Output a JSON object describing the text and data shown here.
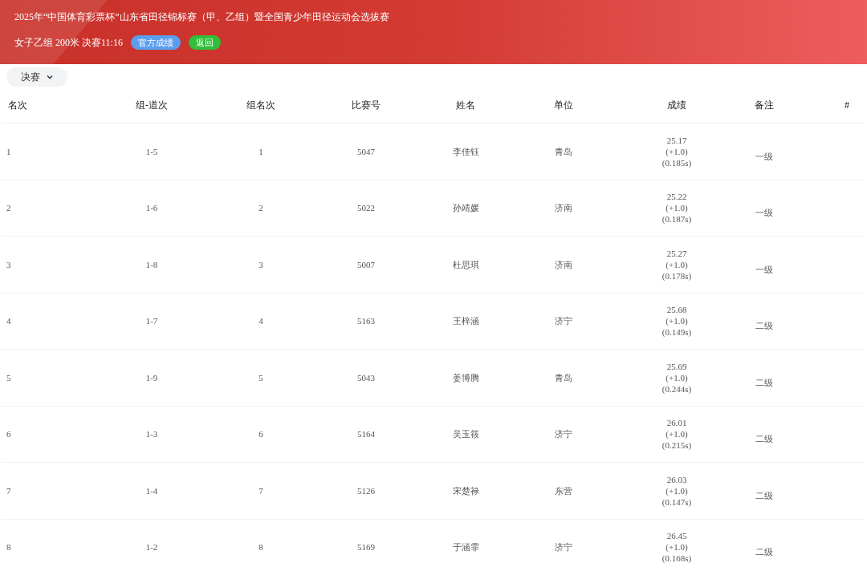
{
  "header": {
    "title": "2025年“中国体育彩票杯”山东省田径锦标赛（甲、乙组）暨全国青少年田径运动会选拔赛",
    "subtitle": "女子乙组 200米 决赛11:16",
    "buttons": [
      {
        "label": "官方成绩",
        "kind": "primary"
      },
      {
        "label": "返回",
        "kind": "success"
      }
    ]
  },
  "round_select": {
    "value": "决赛"
  },
  "table": {
    "columns": [
      "名次",
      "组-道次",
      "组名次",
      "比赛号",
      "姓名",
      "单位",
      "成绩",
      "备注",
      "#"
    ],
    "rows": [
      {
        "rank": "1",
        "group_lane": "1-5",
        "group_rank": "1",
        "bib": "5047",
        "name": "李佳钰",
        "unit": "青岛",
        "time": "25.17",
        "wind": "(+1.0)",
        "reaction": "(0.185s)",
        "note": "一级"
      },
      {
        "rank": "2",
        "group_lane": "1-6",
        "group_rank": "2",
        "bib": "5022",
        "name": "孙靖媛",
        "unit": "济南",
        "time": "25.22",
        "wind": "(+1.0)",
        "reaction": "(0.187s)",
        "note": "一级"
      },
      {
        "rank": "3",
        "group_lane": "1-8",
        "group_rank": "3",
        "bib": "5007",
        "name": "杜思琪",
        "unit": "济南",
        "time": "25.27",
        "wind": "(+1.0)",
        "reaction": "(0.178s)",
        "note": "一级"
      },
      {
        "rank": "4",
        "group_lane": "1-7",
        "group_rank": "4",
        "bib": "5163",
        "name": "王梓涵",
        "unit": "济宁",
        "time": "25.68",
        "wind": "(+1.0)",
        "reaction": "(0.149s)",
        "note": "二级"
      },
      {
        "rank": "5",
        "group_lane": "1-9",
        "group_rank": "5",
        "bib": "5043",
        "name": "姜博腾",
        "unit": "青岛",
        "time": "25.69",
        "wind": "(+1.0)",
        "reaction": "(0.244s)",
        "note": "二级"
      },
      {
        "rank": "6",
        "group_lane": "1-3",
        "group_rank": "6",
        "bib": "5164",
        "name": "吴玉筱",
        "unit": "济宁",
        "time": "26.01",
        "wind": "(+1.0)",
        "reaction": "(0.215s)",
        "note": "二级"
      },
      {
        "rank": "7",
        "group_lane": "1-4",
        "group_rank": "7",
        "bib": "5126",
        "name": "宋楚禄",
        "unit": "东营",
        "time": "26.03",
        "wind": "(+1.0)",
        "reaction": "(0.147s)",
        "note": "二级"
      },
      {
        "rank": "8",
        "group_lane": "1-2",
        "group_rank": "8",
        "bib": "5169",
        "name": "于涵霏",
        "unit": "济宁",
        "time": "26.45",
        "wind": "(+1.0)",
        "reaction": "(0.168s)",
        "note": "二级"
      }
    ]
  }
}
